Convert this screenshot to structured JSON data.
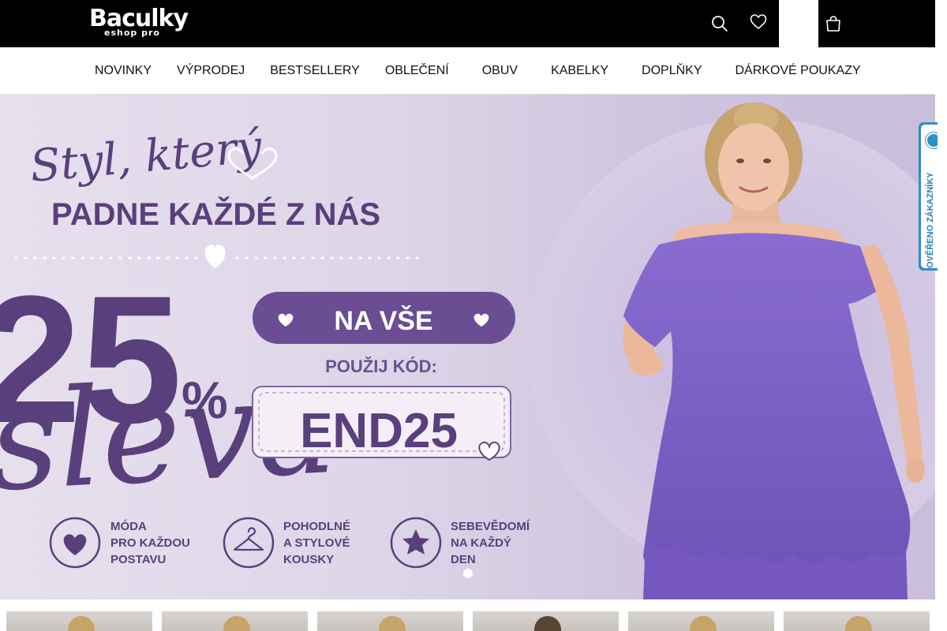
{
  "header": {
    "logo_name": "Baculky",
    "logo_tagline": "eshop pro",
    "icons": [
      "search-icon",
      "heart-icon",
      "account-icon",
      "cart-icon"
    ],
    "account_glyphs": [
      "",
      ""
    ]
  },
  "nav": {
    "items": [
      {
        "label": "NOVINKY",
        "has_dropdown": false
      },
      {
        "label": "VÝPRODEJ",
        "has_dropdown": false
      },
      {
        "label": "BESTSELLERY",
        "has_dropdown": false
      },
      {
        "label": "OBLEČENÍ",
        "has_dropdown": true
      },
      {
        "label": "OBUV",
        "has_dropdown": true
      },
      {
        "label": "KABELKY",
        "has_dropdown": true
      },
      {
        "label": "DOPLŇKY",
        "has_dropdown": true
      },
      {
        "label": "DÁRKOVÉ POUKAZY",
        "has_dropdown": false
      }
    ],
    "chevron": "",
    "scroll_arrow": ""
  },
  "hero": {
    "script_line": "Styl, který",
    "headline": "PADNE KAŽDÉ Z NÁS",
    "discount_number": "25",
    "discount_percent": "%",
    "discount_word": "sleva",
    "pill_text": "NA VŠE",
    "use_code_label": "POUŽIJ KÓD:",
    "code": "END25",
    "features": [
      {
        "icon": "heart-icon",
        "lines": [
          "MÓDA",
          "PRO KAŽDOU",
          "POSTAVU"
        ]
      },
      {
        "icon": "hanger-icon",
        "lines": [
          "POHODLNÉ",
          "A STYLOVÉ",
          "KOUSKY"
        ]
      },
      {
        "icon": "star-icon",
        "lines": [
          "SEBEVĚDOMÍ",
          "NA KAŽDÝ",
          "DEN"
        ]
      }
    ],
    "slide_dots": 1,
    "active_slide": 1,
    "colors": {
      "accent": "#5a3f7d",
      "dress": "#7e5fc4",
      "background": "#ddd6e8"
    }
  },
  "verified_badge": {
    "text": "OVĚŘENO ZÁKAZNÍKY",
    "color": "#2f8fc8"
  },
  "products": {
    "count": 6
  }
}
